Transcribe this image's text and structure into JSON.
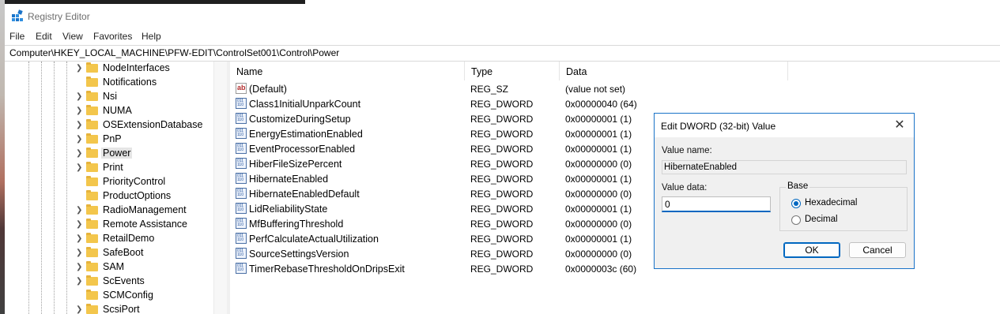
{
  "window": {
    "title": "Registry Editor"
  },
  "menu": [
    "File",
    "Edit",
    "View",
    "Favorites",
    "Help"
  ],
  "address": "Computer\\HKEY_LOCAL_MACHINE\\PFW-EDIT\\ControlSet001\\Control\\Power",
  "tree": {
    "items": [
      {
        "label": "NodeInterfaces",
        "expandable": true
      },
      {
        "label": "Notifications",
        "expandable": false
      },
      {
        "label": "Nsi",
        "expandable": true
      },
      {
        "label": "NUMA",
        "expandable": true
      },
      {
        "label": "OSExtensionDatabase",
        "expandable": true
      },
      {
        "label": "PnP",
        "expandable": true
      },
      {
        "label": "Power",
        "expandable": true,
        "selected": true
      },
      {
        "label": "Print",
        "expandable": true
      },
      {
        "label": "PriorityControl",
        "expandable": false
      },
      {
        "label": "ProductOptions",
        "expandable": false
      },
      {
        "label": "RadioManagement",
        "expandable": true
      },
      {
        "label": "Remote Assistance",
        "expandable": true
      },
      {
        "label": "RetailDemo",
        "expandable": true
      },
      {
        "label": "SafeBoot",
        "expandable": true
      },
      {
        "label": "SAM",
        "expandable": true
      },
      {
        "label": "ScEvents",
        "expandable": true
      },
      {
        "label": "SCMConfig",
        "expandable": false
      },
      {
        "label": "ScsiPort",
        "expandable": true
      }
    ]
  },
  "columns": {
    "name": "Name",
    "type": "Type",
    "data": "Data"
  },
  "values": [
    {
      "name": "(Default)",
      "type": "REG_SZ",
      "data": "(value not set)",
      "icon": "string"
    },
    {
      "name": "Class1InitialUnparkCount",
      "type": "REG_DWORD",
      "data": "0x00000040 (64)",
      "icon": "binary"
    },
    {
      "name": "CustomizeDuringSetup",
      "type": "REG_DWORD",
      "data": "0x00000001 (1)",
      "icon": "binary"
    },
    {
      "name": "EnergyEstimationEnabled",
      "type": "REG_DWORD",
      "data": "0x00000001 (1)",
      "icon": "binary"
    },
    {
      "name": "EventProcessorEnabled",
      "type": "REG_DWORD",
      "data": "0x00000001 (1)",
      "icon": "binary"
    },
    {
      "name": "HiberFileSizePercent",
      "type": "REG_DWORD",
      "data": "0x00000000 (0)",
      "icon": "binary"
    },
    {
      "name": "HibernateEnabled",
      "type": "REG_DWORD",
      "data": "0x00000001 (1)",
      "icon": "binary"
    },
    {
      "name": "HibernateEnabledDefault",
      "type": "REG_DWORD",
      "data": "0x00000000 (0)",
      "icon": "binary"
    },
    {
      "name": "LidReliabilityState",
      "type": "REG_DWORD",
      "data": "0x00000001 (1)",
      "icon": "binary"
    },
    {
      "name": "MfBufferingThreshold",
      "type": "REG_DWORD",
      "data": "0x00000000 (0)",
      "icon": "binary"
    },
    {
      "name": "PerfCalculateActualUtilization",
      "type": "REG_DWORD",
      "data": "0x00000001 (1)",
      "icon": "binary"
    },
    {
      "name": "SourceSettingsVersion",
      "type": "REG_DWORD",
      "data": "0x00000000 (0)",
      "icon": "binary"
    },
    {
      "name": "TimerRebaseThresholdOnDripsExit",
      "type": "REG_DWORD",
      "data": "0x0000003c (60)",
      "icon": "binary"
    }
  ],
  "dialog": {
    "title": "Edit DWORD (32-bit) Value",
    "value_name_label": "Value name:",
    "value_name": "HibernateEnabled",
    "value_data_label": "Value data:",
    "value_data": "0",
    "base_label": "Base",
    "base_options": [
      {
        "label": "Hexadecimal",
        "selected": true
      },
      {
        "label": "Decimal",
        "selected": false
      }
    ],
    "ok": "OK",
    "cancel": "Cancel"
  }
}
